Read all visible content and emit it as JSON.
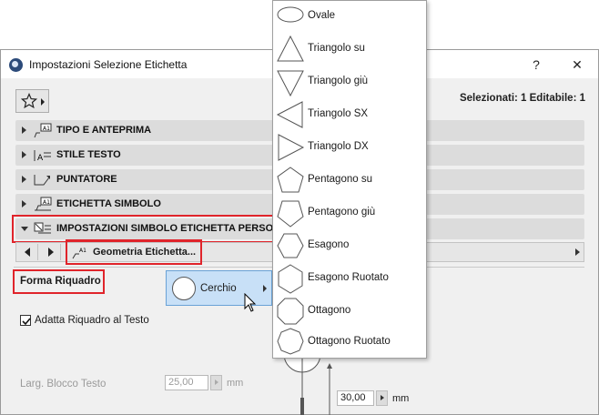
{
  "window": {
    "title": "Impostazioni Selezione Etichetta",
    "help_label": "?",
    "close_label": "✕"
  },
  "selection_info": "Selezionati: 1 Editabile: 1",
  "panels": [
    {
      "label": "TIPO E ANTEPRIMA",
      "icon": "label-preview-icon",
      "expanded": false
    },
    {
      "label": "STILE TESTO",
      "icon": "text-style-icon",
      "expanded": false
    },
    {
      "label": "PUNTATORE",
      "icon": "pointer-icon",
      "expanded": false
    },
    {
      "label": "ETICHETTA SIMBOLO",
      "icon": "symbol-label-icon",
      "expanded": false
    },
    {
      "label": "IMPOSTAZIONI SIMBOLO ETICHETTA PERSONA",
      "icon": "custom-settings-icon",
      "expanded": true
    }
  ],
  "navbar": {
    "page_label": "Geometria Etichetta..."
  },
  "form": {
    "shape_label": "Forma Riquadro",
    "shape_value": "Cerchio",
    "fit_label": "Adatta Riquadro al Testo",
    "fit_checked": true,
    "block_width_label": "Larg. Blocco Testo",
    "block_width_value": "25,00",
    "block_width_unit": "mm",
    "size_value": "30,00",
    "size_unit": "mm"
  },
  "shape_menu": [
    {
      "label": "Ovale",
      "icon": "oval-icon"
    },
    {
      "label": "Triangolo su",
      "icon": "triangle-up-icon"
    },
    {
      "label": "Triangolo giù",
      "icon": "triangle-down-icon"
    },
    {
      "label": "Triangolo SX",
      "icon": "triangle-left-icon"
    },
    {
      "label": "Triangolo DX",
      "icon": "triangle-right-icon"
    },
    {
      "label": "Pentagono su",
      "icon": "pentagon-up-icon"
    },
    {
      "label": "Pentagono giù",
      "icon": "pentagon-down-icon"
    },
    {
      "label": "Esagono",
      "icon": "hexagon-icon"
    },
    {
      "label": "Esagono Ruotato",
      "icon": "hexagon-rotated-icon"
    },
    {
      "label": "Ottagono",
      "icon": "octagon-icon"
    },
    {
      "label": "Ottagono Ruotato",
      "icon": "octagon-rotated-icon"
    }
  ],
  "colors": {
    "highlight_border": "#e0242b",
    "selected_button": "#c8e0f7"
  }
}
